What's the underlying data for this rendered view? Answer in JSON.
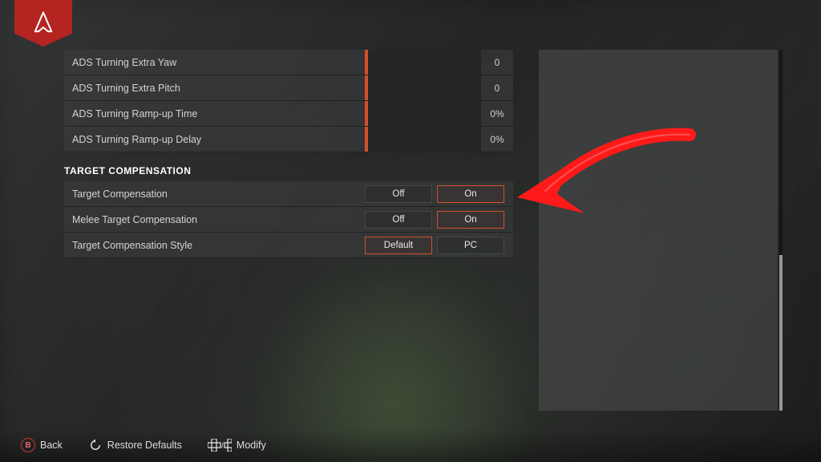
{
  "sliders": [
    {
      "label": "ADS Turning Extra Yaw",
      "value": "0"
    },
    {
      "label": "ADS Turning Extra Pitch",
      "value": "0"
    },
    {
      "label": "ADS Turning Ramp-up Time",
      "value": "0%"
    },
    {
      "label": "ADS Turning Ramp-up Delay",
      "value": "0%"
    }
  ],
  "section_title": "TARGET COMPENSATION",
  "toggles": [
    {
      "label": "Target Compensation",
      "opts": [
        "Off",
        "On"
      ],
      "selected": 1
    },
    {
      "label": "Melee Target Compensation",
      "opts": [
        "Off",
        "On"
      ],
      "selected": 1
    },
    {
      "label": "Target Compensation Style",
      "opts": [
        "Default",
        "PC"
      ],
      "selected": 0
    }
  ],
  "footer": {
    "back_key": "B",
    "back": "Back",
    "restore": "Restore Defaults",
    "modify": "Modify"
  }
}
